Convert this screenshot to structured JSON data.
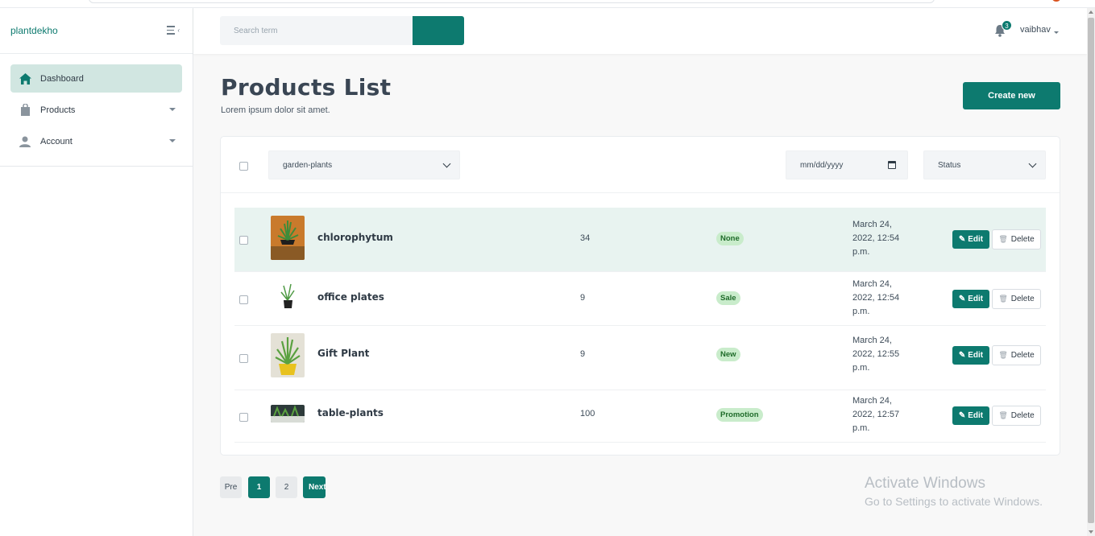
{
  "app": {
    "brand": "plantdekho"
  },
  "sidebar": {
    "items": [
      {
        "label": "Dashboard",
        "icon": "home-icon",
        "active": true
      },
      {
        "label": "Products",
        "icon": "shopping-bag-icon",
        "expandable": true
      },
      {
        "label": "Account",
        "icon": "user-icon",
        "expandable": true
      }
    ]
  },
  "header": {
    "search_placeholder": "Search term",
    "notification_count": "3",
    "username": "vaibhav"
  },
  "page": {
    "title": "Products List",
    "subtitle": "Lorem ipsum dolor sit amet.",
    "create_label": "Create new"
  },
  "filters": {
    "category": "garden-plants",
    "date_placeholder": "mm/dd/yyyy",
    "status": "Status"
  },
  "products": [
    {
      "name": "chlorophytum",
      "qty": "34",
      "status": "None",
      "date": "March 24, 2022, 12:54 p.m.",
      "highlighted": true
    },
    {
      "name": "office plates",
      "qty": "9",
      "status": "Sale",
      "date": "March 24, 2022, 12:54 p.m."
    },
    {
      "name": "Gift Plant",
      "qty": "9",
      "status": "New",
      "date": "March 24, 2022, 12:55 p.m."
    },
    {
      "name": "table-plants",
      "qty": "100",
      "status": "Promotion",
      "date": "March 24, 2022, 12:57 p.m."
    }
  ],
  "actions": {
    "edit_label": "Edit",
    "delete_label": "Delete"
  },
  "pagination": {
    "prev": "Pre",
    "pages": [
      "1",
      "2"
    ],
    "current": "1",
    "next": "Next"
  },
  "watermark": {
    "line1": "Activate Windows",
    "line2": "Go to Settings to activate Windows."
  },
  "colors": {
    "accent": "#0d7a6f",
    "active_nav": "#d1e6e1",
    "highlight_row": "#e8f3f0",
    "status_badge": "#c9eccb"
  }
}
